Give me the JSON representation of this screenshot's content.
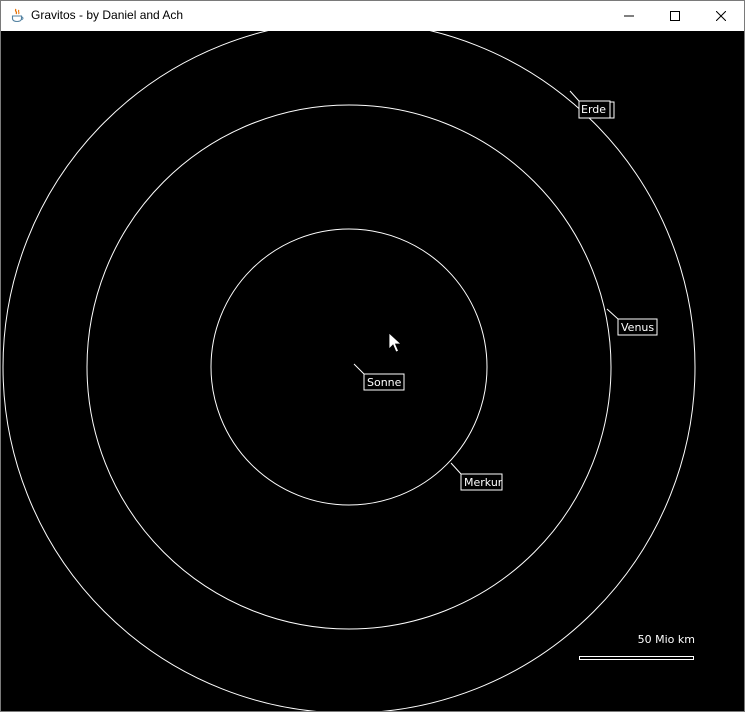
{
  "window": {
    "title": "Gravitos - by Daniel and Ach",
    "icon": "java-cup-icon",
    "controls": [
      "minimize-icon",
      "maximize-icon",
      "close-icon"
    ]
  },
  "simulation": {
    "background": "#000000",
    "orbit_color": "#ffffff",
    "bodies": [
      {
        "name": "Sonne"
      },
      {
        "name": "Merkur"
      },
      {
        "name": "Venus"
      },
      {
        "name": "Erde"
      }
    ],
    "scale": {
      "label": "50 Mio km"
    }
  }
}
